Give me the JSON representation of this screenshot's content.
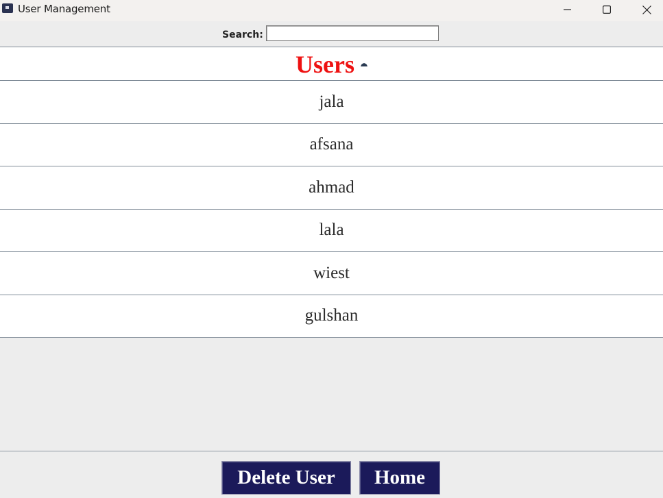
{
  "window": {
    "title": "User Management",
    "icon": "app-window-icon",
    "controls": [
      "minimize-icon",
      "maximize-icon",
      "close-icon"
    ]
  },
  "search": {
    "label": "Search:",
    "value": "",
    "placeholder": ""
  },
  "table": {
    "header": "Users",
    "sort_icon": "sort-ascending-icon",
    "rows": [
      "jala",
      "afsana",
      "ahmad",
      "lala",
      "wiest",
      "gulshan"
    ]
  },
  "actions": {
    "delete_label": "Delete User",
    "home_label": "Home"
  },
  "colors": {
    "header_text": "#ee1111",
    "button_bg": "#1b1a5a",
    "button_text": "#ffffff",
    "window_bg": "#ededed"
  }
}
